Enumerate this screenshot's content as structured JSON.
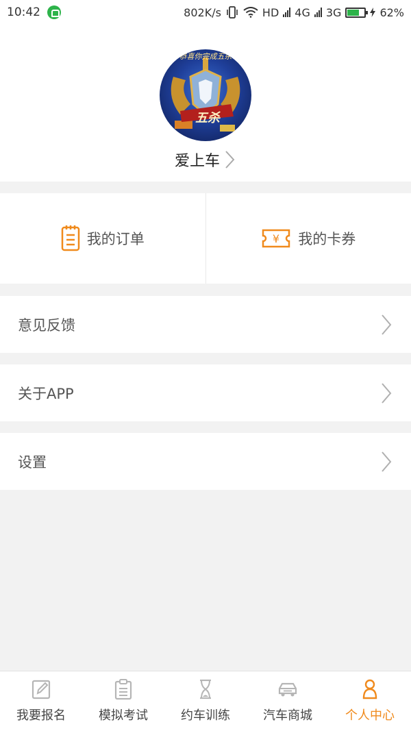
{
  "status_bar": {
    "time": "10:42",
    "speed": "802K/s",
    "hd": "HD",
    "net_4g": "4G",
    "net_3g": "3G",
    "battery": "62%",
    "battery_level": 0.62
  },
  "profile": {
    "avatar_caption": "恭喜你完成五杀",
    "avatar_badge": "五杀",
    "username": "爱上车"
  },
  "quick_actions": {
    "orders_label": "我的订单",
    "coupons_label": "我的卡券",
    "coupon_symbol": "¥"
  },
  "menu": {
    "feedback": "意见反馈",
    "about": "关于APP",
    "settings": "设置"
  },
  "bottom_nav": {
    "items": [
      {
        "label": "我要报名",
        "icon": "edit-icon"
      },
      {
        "label": "模拟考试",
        "icon": "clipboard-icon"
      },
      {
        "label": "约车训练",
        "icon": "hourglass-icon"
      },
      {
        "label": "汽车商城",
        "icon": "car-icon"
      },
      {
        "label": "个人中心",
        "icon": "person-icon"
      }
    ],
    "active_index": 4,
    "active_color": "#f08a1c",
    "inactive_icon_color": "#b5b5b5"
  },
  "colors": {
    "accent": "#f08a1c",
    "background": "#f2f2f2"
  }
}
